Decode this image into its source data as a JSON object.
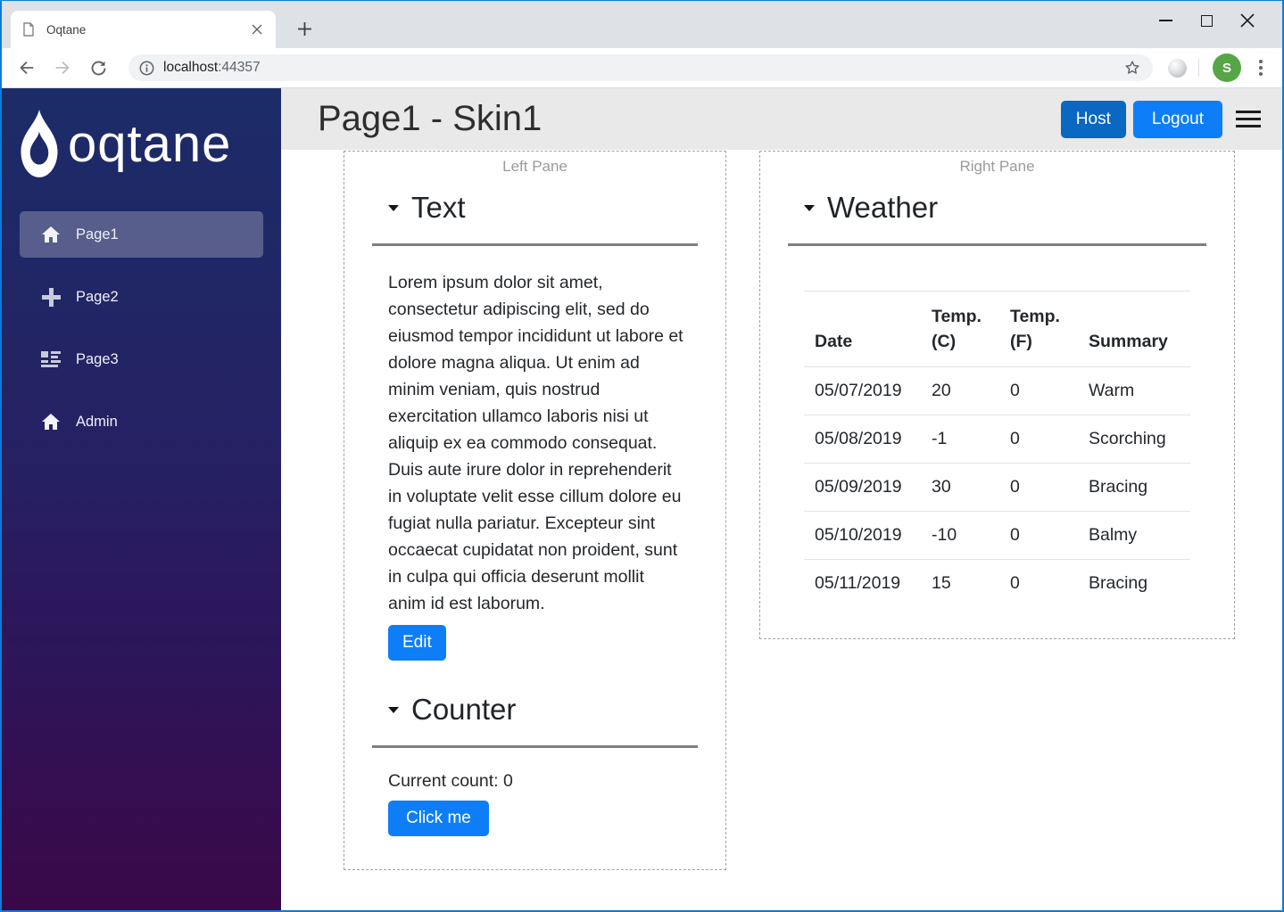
{
  "browser": {
    "tab_title": "Oqtane",
    "url_host": "localhost",
    "url_port": ":44357",
    "avatar_initial": "S"
  },
  "sidebar": {
    "logo_text": "oqtane",
    "items": [
      {
        "label": "Page1",
        "icon": "home-icon",
        "active": true
      },
      {
        "label": "Page2",
        "icon": "plus-icon",
        "active": false
      },
      {
        "label": "Page3",
        "icon": "list-rich-icon",
        "active": false
      },
      {
        "label": "Admin",
        "icon": "home-icon",
        "active": false
      }
    ]
  },
  "header": {
    "title": "Page1 - Skin1",
    "host_label": "Host",
    "logout_label": "Logout"
  },
  "panes": {
    "left": {
      "label": "Left Pane",
      "text_module": {
        "title": "Text",
        "body": "Lorem ipsum dolor sit amet, consectetur adipiscing elit, sed do eiusmod tempor incididunt ut labore et dolore magna aliqua. Ut enim ad minim veniam, quis nostrud exercitation ullamco laboris nisi ut aliquip ex ea commodo consequat. Duis aute irure dolor in reprehenderit in voluptate velit esse cillum dolore eu fugiat nulla pariatur. Excepteur sint occaecat cupidatat non proident, sunt in culpa qui officia deserunt mollit anim id est laborum.",
        "edit_label": "Edit"
      },
      "counter_module": {
        "title": "Counter",
        "count_text": "Current count: 0",
        "button_label": "Click me"
      }
    },
    "right": {
      "label": "Right Pane",
      "weather_module": {
        "title": "Weather",
        "table": {
          "headers": [
            "Date",
            "Temp. (C)",
            "Temp. (F)",
            "Summary"
          ],
          "rows": [
            {
              "date": "05/07/2019",
              "temp_c": "20",
              "temp_f": "0",
              "summary": "Warm"
            },
            {
              "date": "05/08/2019",
              "temp_c": "-1",
              "temp_f": "0",
              "summary": "Scorching"
            },
            {
              "date": "05/09/2019",
              "temp_c": "30",
              "temp_f": "0",
              "summary": "Bracing"
            },
            {
              "date": "05/10/2019",
              "temp_c": "-10",
              "temp_f": "0",
              "summary": "Balmy"
            },
            {
              "date": "05/11/2019",
              "temp_c": "15",
              "temp_f": "0",
              "summary": "Bracing"
            }
          ]
        }
      }
    }
  },
  "colors": {
    "window_border": "#0b7cd9",
    "tabbar_bg": "#dee1e6",
    "header_bg": "#e9e9e9",
    "sidebar_gradient_top": "#1c2c68",
    "sidebar_gradient_bottom": "#3a0848",
    "primary_button": "#0d7ef8",
    "host_button": "#0a67c2",
    "avatar_green": "#56a546"
  }
}
